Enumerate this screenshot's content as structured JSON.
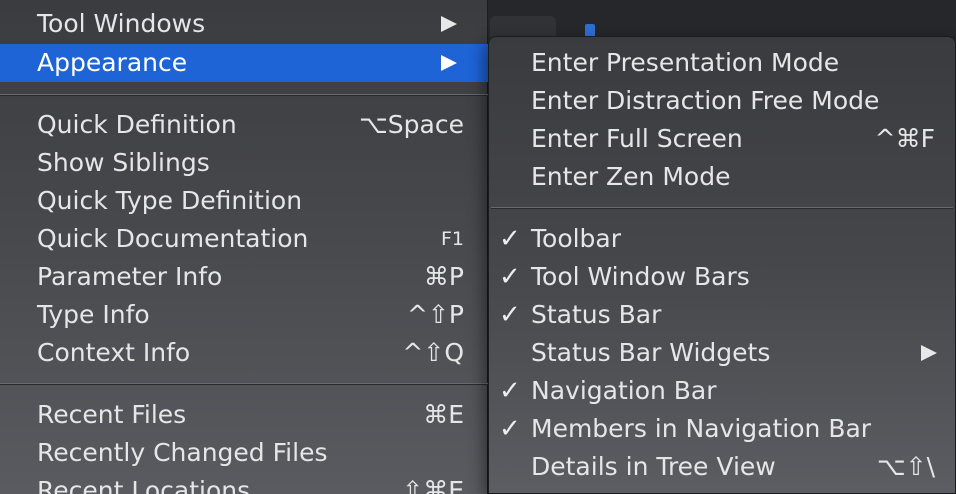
{
  "main_menu": {
    "items": [
      {
        "label": "Tool Windows",
        "shortcut": "",
        "submenu": true,
        "selected": false
      },
      {
        "label": "Appearance",
        "shortcut": "",
        "submenu": true,
        "selected": true
      },
      {
        "label": "Quick Definition",
        "shortcut": "⌥Space"
      },
      {
        "label": "Show Siblings",
        "shortcut": ""
      },
      {
        "label": "Quick Type Definition",
        "shortcut": ""
      },
      {
        "label": "Quick Documentation",
        "shortcut": "F1"
      },
      {
        "label": "Parameter Info",
        "shortcut": "⌘P"
      },
      {
        "label": "Type Info",
        "shortcut": "^⇧P"
      },
      {
        "label": "Context Info",
        "shortcut": "^⇧Q"
      },
      {
        "label": "Recent Files",
        "shortcut": "⌘E"
      },
      {
        "label": "Recently Changed Files",
        "shortcut": ""
      },
      {
        "label": "Recent Locations",
        "shortcut": "⇧⌘E"
      }
    ]
  },
  "appearance_submenu": {
    "items": [
      {
        "label": "Enter Presentation Mode",
        "shortcut": "",
        "checked": false
      },
      {
        "label": "Enter Distraction Free Mode",
        "shortcut": "",
        "checked": false
      },
      {
        "label": "Enter Full Screen",
        "shortcut": "^⌘F",
        "checked": false
      },
      {
        "label": "Enter Zen Mode",
        "shortcut": "",
        "checked": false
      },
      {
        "label": "Toolbar",
        "shortcut": "",
        "checked": true
      },
      {
        "label": "Tool Window Bars",
        "shortcut": "",
        "checked": true
      },
      {
        "label": "Status Bar",
        "shortcut": "",
        "checked": true
      },
      {
        "label": "Status Bar Widgets",
        "shortcut": "",
        "checked": false,
        "submenu": true
      },
      {
        "label": "Navigation Bar",
        "shortcut": "",
        "checked": true
      },
      {
        "label": "Members in Navigation Bar",
        "shortcut": "",
        "checked": true
      },
      {
        "label": "Details in Tree View",
        "shortcut": "⌥⇧\\",
        "checked": false
      }
    ],
    "checkmark": "✓"
  },
  "colors": {
    "selection": "#1e64d6",
    "menu_text": "#e6e6e6"
  }
}
